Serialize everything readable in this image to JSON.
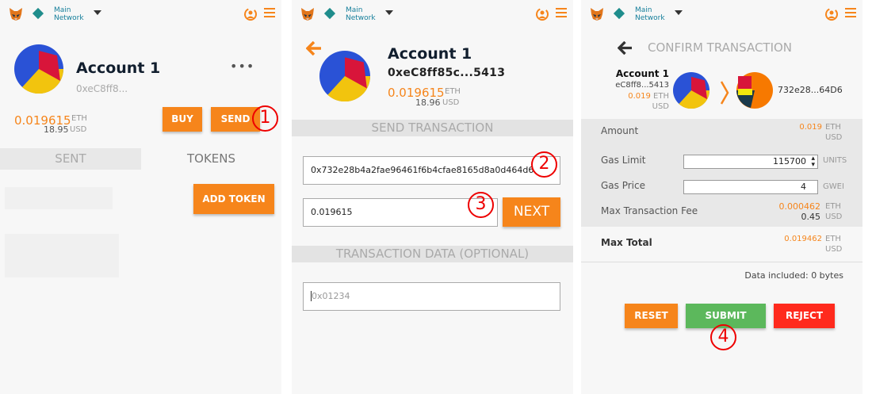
{
  "header": {
    "network_line1": "Main",
    "network_line2": "Network"
  },
  "panel1": {
    "account_name": "Account 1",
    "address": "0xeC8ff8...",
    "menu": "•••",
    "eth_value": "0.019615",
    "eth_unit": "ETH",
    "usd_value": "18.95",
    "usd_unit": "USD",
    "buy_label": "BUY",
    "send_label": "SEND",
    "tab_sent": "SENT",
    "tab_tokens": "TOKENS",
    "add_token_label": "ADD TOKEN",
    "step": "1"
  },
  "panel2": {
    "account_name": "Account 1",
    "address": "0xeC8ff85c...5413",
    "eth_value": "0.019615",
    "eth_unit": "ETH",
    "usd_value": "18.96",
    "usd_unit": "USD",
    "section_send": "SEND TRANSACTION",
    "recipient_value": "0x732e28b4a2fae96461f6b4cfae8165d8a0d464d6",
    "amount_value": "0.019615",
    "next_label": "NEXT",
    "section_data": "TRANSACTION DATA (OPTIONAL)",
    "data_placeholder": "0x01234",
    "step_recipient": "2",
    "step_amount": "3"
  },
  "panel3": {
    "title": "CONFIRM TRANSACTION",
    "from_name": "Account 1",
    "from_address": "eC8ff8...5413",
    "from_eth": "0.019",
    "from_eth_unit": "ETH",
    "from_usd_unit": "USD",
    "to_address": "732e28...64D6",
    "amount_label": "Amount",
    "amount_value": "0.019",
    "amount_eth_unit": "ETH",
    "amount_usd_unit": "USD",
    "gas_limit_label": "Gas Limit",
    "gas_limit_value": "115700",
    "gas_limit_unit": "UNITS",
    "gas_price_label": "Gas Price",
    "gas_price_value": "4",
    "gas_price_unit": "GWEI",
    "max_fee_label": "Max Transaction Fee",
    "max_fee_eth": "0.000462",
    "max_fee_eth_unit": "ETH",
    "max_fee_usd": "0.45",
    "max_fee_usd_unit": "USD",
    "max_total_label": "Max Total",
    "max_total_eth": "0.019462",
    "max_total_eth_unit": "ETH",
    "max_total_usd_unit": "USD",
    "data_included": "Data included: 0 bytes",
    "reset_label": "RESET",
    "submit_label": "SUBMIT",
    "reject_label": "REJECT",
    "step": "4"
  },
  "colors": {
    "accent": "#f6851b",
    "submit": "#5cb85c",
    "reject": "#ff2a1d",
    "network": "#1f8d8c"
  }
}
